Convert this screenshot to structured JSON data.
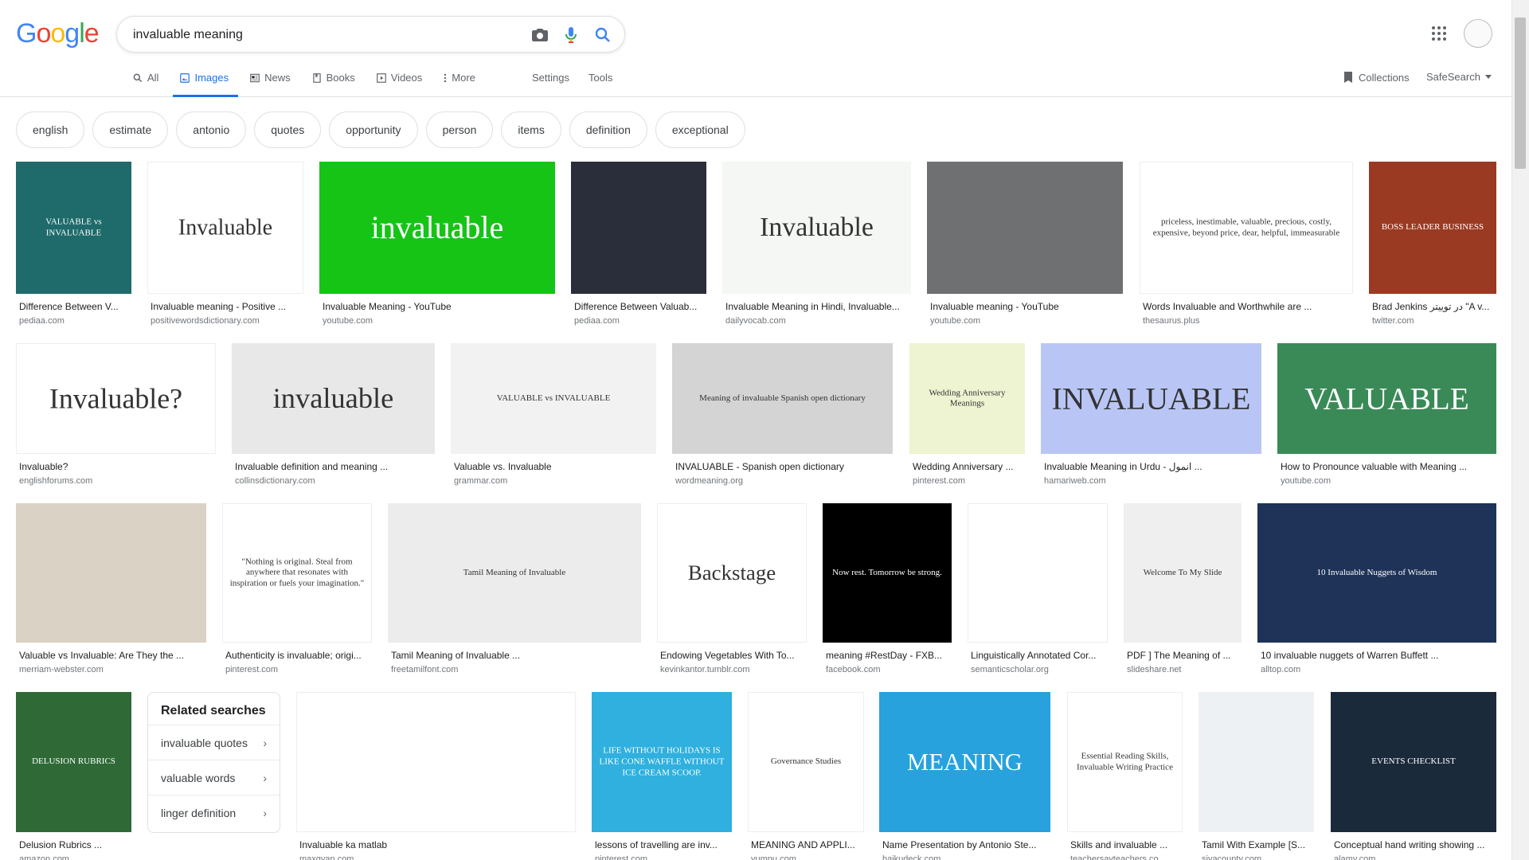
{
  "header": {
    "search_value": "invaluable meaning",
    "logo_text": "Google"
  },
  "tabs": [
    {
      "label": "All"
    },
    {
      "label": "Images"
    },
    {
      "label": "News"
    },
    {
      "label": "Books"
    },
    {
      "label": "Videos"
    },
    {
      "label": "More"
    }
  ],
  "tools": {
    "settings": "Settings",
    "tools": "Tools"
  },
  "right": {
    "collections": "Collections",
    "safesearch": "SafeSearch"
  },
  "chips": [
    "english",
    "estimate",
    "antonio",
    "quotes",
    "opportunity",
    "person",
    "items",
    "definition",
    "exceptional"
  ],
  "images": [
    {
      "title": "Difference Between V...",
      "source": "pediaa.com",
      "bg": "#1f6a6a",
      "text": "VALUABLE vs INVALUABLE"
    },
    {
      "title": "Invaluable meaning - Positive ...",
      "source": "positivewordsdictionary.com",
      "bg": "#ffffff",
      "text": "Invaluable"
    },
    {
      "title": "Invaluable Meaning - YouTube",
      "source": "youtube.com",
      "bg": "#16c416",
      "text": "invaluable"
    },
    {
      "title": "Difference Between Valuab...",
      "source": "pediaa.com",
      "bg": "#2a2d3a",
      "text": ""
    },
    {
      "title": "Invaluable Meaning in Hindi, Invaluable...",
      "source": "dailyvocab.com",
      "bg": "#f4f7f4",
      "text": "Invaluable"
    },
    {
      "title": "Invaluable meaning - YouTube",
      "source": "youtube.com",
      "bg": "#6f7071",
      "text": ""
    },
    {
      "title": "Words Invaluable and Worthwhile are ...",
      "source": "thesaurus.plus",
      "bg": "#ffffff",
      "text": "priceless, inestimable, valuable, precious, costly, expensive, beyond price, dear, helpful, immeasurable"
    },
    {
      "title": "Brad Jenkins در توییتر \"A v...",
      "source": "twitter.com",
      "bg": "#9b3a22",
      "text": "BOSS LEADER BUSINESS"
    },
    {
      "title": "Invaluable?",
      "source": "englishforums.com",
      "bg": "#ffffff",
      "text": "Invaluable?"
    },
    {
      "title": "Invaluable definition and meaning ...",
      "source": "collinsdictionary.com",
      "bg": "#e8e8e8",
      "text": "invaluable"
    },
    {
      "title": "Valuable vs. Invaluable",
      "source": "grammar.com",
      "bg": "#f2f2f2",
      "text": "VALUABLE vs INVALUABLE"
    },
    {
      "title": "INVALUABLE - Spanish open dictionary",
      "source": "wordmeaning.org",
      "bg": "#d4d4d4",
      "text": "Meaning of invaluable Spanish open dictionary"
    },
    {
      "title": "Wedding Anniversary ...",
      "source": "pinterest.com",
      "bg": "#eef3d2",
      "text": "Wedding Anniversary Meanings"
    },
    {
      "title": "Invaluable Meaning in Urdu - انمول ...",
      "source": "hamariweb.com",
      "bg": "#b9c6f5",
      "text": "INVALUABLE"
    },
    {
      "title": "How to Pronounce valuable with Meaning ...",
      "source": "youtube.com",
      "bg": "#3a8a58",
      "text": "VALUABLE"
    },
    {
      "title": "Valuable vs Invaluable: Are They the ...",
      "source": "merriam-webster.com",
      "bg": "#d9d2c5",
      "text": ""
    },
    {
      "title": "Authenticity is invaluable; origi...",
      "source": "pinterest.com",
      "bg": "#ffffff",
      "text": "\"Nothing is original. Steal from anywhere that resonates with inspiration or fuels your imagination.\""
    },
    {
      "title": "Tamil Meaning of Invaluable ...",
      "source": "freetamilfont.com",
      "bg": "#ececec",
      "text": "Tamil Meaning of Invaluable"
    },
    {
      "title": "Endowing Vegetables With To...",
      "source": "kevinkantor.tumblr.com",
      "bg": "#ffffff",
      "text": "Backstage"
    },
    {
      "title": "meaning #RestDay - FXB...",
      "source": "facebook.com",
      "bg": "#000000",
      "text": "Now rest. Tomorrow be strong."
    },
    {
      "title": "Linguistically Annotated Cor...",
      "source": "semanticscholar.org",
      "bg": "#ffffff",
      "text": ""
    },
    {
      "title": "PDF ] The Meaning of ...",
      "source": "slideshare.net",
      "bg": "#efefef",
      "text": "Welcome To My Slide"
    },
    {
      "title": "10 invaluable nuggets of Warren Buffett ...",
      "source": "alltop.com",
      "bg": "#1e3357",
      "text": "10 Invaluable Nuggets of Wisdom"
    },
    {
      "title": "Delusion Rubrics ...",
      "source": "amazon.com",
      "bg": "#2f6a36",
      "text": "DELUSION RUBRICS"
    },
    {
      "title": "Invaluable ka matlab",
      "source": "maxgyan.com",
      "bg": "#ffffff",
      "text": ""
    },
    {
      "title": "lessons of travelling are inv...",
      "source": "pinterest.com",
      "bg": "#2fb0de",
      "text": "LIFE WITHOUT HOLIDAYS IS LIKE CONE WAFFLE WITHOUT ICE CREAM SCOOP."
    },
    {
      "title": "MEANING AND APPLI...",
      "source": "yumpu.com",
      "bg": "#ffffff",
      "text": "Governance Studies"
    },
    {
      "title": "Name Presentation by Antonio Ste...",
      "source": "haikudeck.com",
      "bg": "#27a2dd",
      "text": "MEANING"
    },
    {
      "title": "Skills and invaluable ...",
      "source": "teachersayteachers.co...",
      "bg": "#ffffff",
      "text": "Essential Reading Skills, Invaluable Writing Practice"
    },
    {
      "title": "Tamil With Example [S...",
      "source": "siyacounty.com",
      "bg": "#eef1f3",
      "text": ""
    },
    {
      "title": "Conceptual hand writing showing ...",
      "source": "alamy.com",
      "bg": "#1a2a3a",
      "text": "EVENTS CHECKLIST"
    }
  ],
  "related": {
    "heading": "Related searches",
    "items": [
      "invaluable quotes",
      "valuable words",
      "linger definition"
    ]
  },
  "colors": {
    "accent": "#1a73e8",
    "text": "#202124",
    "muted": "#70757a"
  }
}
